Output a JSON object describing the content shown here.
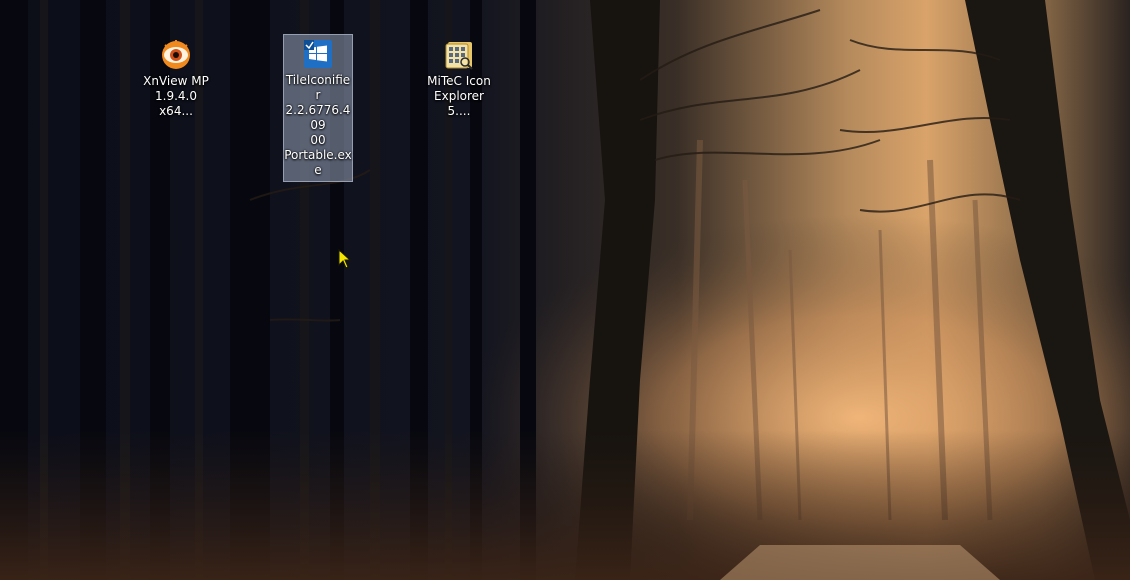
{
  "desktop": {
    "icons": [
      {
        "id": "xnview",
        "lines": [
          "XnView MP",
          "1.9.4.0 x64..."
        ],
        "selected": false,
        "icon": "xnview-eye-icon"
      },
      {
        "id": "tileiconifier",
        "lines": [
          "TileIconifier",
          "2.2.6776.409",
          "00",
          "Portable.exe"
        ],
        "selected": true,
        "icon": "tileiconifier-windows-icon"
      },
      {
        "id": "mitec",
        "lines": [
          "MiTeC Icon",
          "Explorer 5...."
        ],
        "selected": false,
        "icon": "mitec-icon-explorer-icon"
      }
    ]
  },
  "colors": {
    "selection": "#96a2b9",
    "cursor": "#f5e600",
    "xnview_orange": "#f08a1e",
    "tileiconifier_blue": "#1f6fc5"
  }
}
